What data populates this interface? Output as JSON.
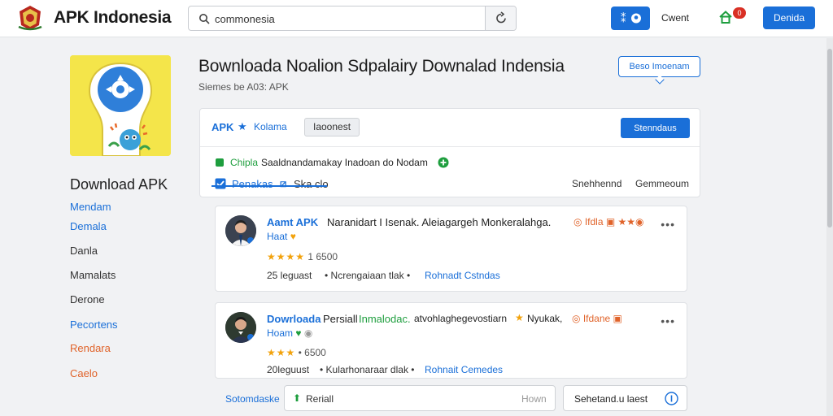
{
  "header": {
    "brand": "APK Indonesia",
    "search_value": "commonesia",
    "user_label": "Cwent",
    "notif_count": "0",
    "primary_button": "Denida"
  },
  "sidebar": {
    "title": "Download APK",
    "items": [
      {
        "label": "Mendam",
        "color": "#1a6fd8"
      },
      {
        "label": "Demala",
        "color": "#1a6fd8"
      },
      {
        "label": "Danla",
        "color": "#333333"
      },
      {
        "label": "Mamalats",
        "color": "#333333"
      },
      {
        "label": "Derone",
        "color": "#333333"
      },
      {
        "label": "Pecortens",
        "color": "#1a6fd8"
      },
      {
        "label": "Rendara",
        "color": "#e0632a"
      },
      {
        "label": "Caelo",
        "color": "#e0632a"
      }
    ]
  },
  "main": {
    "title": "Bownloada Noalion Sdpalairy Downalad Indensia",
    "subtitle": "Siemes be A03: APK",
    "outline_button": "Beso Imoenam",
    "panel": {
      "apk_label": "APK",
      "rating_label": "Kolama",
      "pill": "Iaoonest",
      "button": "Stenndaus",
      "notice_prefix": "Chipla",
      "notice_text": "Saaldnandamakay Inadoan do Nodam",
      "tab_active": "Penakas",
      "tab_other": "Ska clo",
      "sort_left": "Snehhennd",
      "sort_right": "Gemmeoum"
    },
    "cards": [
      {
        "title_accent": "Aamt APK",
        "title_text": "Naranidart I Isenak. Aleiagargeh Monkeralahga.",
        "title_tail": "Ifdla",
        "second_line": "Haat",
        "rating": "1 6500",
        "meta_left": "25 leguast",
        "meta_mid": "Ncrengaiaan tlak",
        "meta_link": "Rohnadt Cstndas"
      },
      {
        "title_accent": "Dowrloada",
        "title_text": "Persiall",
        "title_green": "Inmalodac.",
        "title_rest": "atvohlaghegevostiarn",
        "title_tail2": "Nyukak,",
        "title_badge": "Ifdane",
        "second_line": "Hoam",
        "rating": "6500",
        "meta_left": "20leguust",
        "meta_mid": "Kularhonaraar dlak",
        "meta_link": "Rohnait Cemedes"
      }
    ],
    "bottom": {
      "link": "Sotomdaske",
      "input_label": "Reriall",
      "input_hint": "Hown",
      "button": "Sehetand.u laest"
    }
  },
  "colors": {
    "accent": "#1a6fd8",
    "star": "#f2a20c",
    "green": "#1e9e3e",
    "orange": "#e0632a"
  }
}
